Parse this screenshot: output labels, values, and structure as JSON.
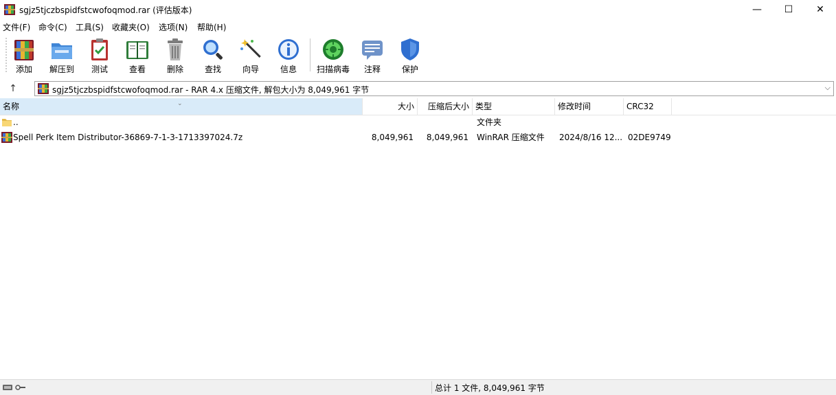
{
  "window": {
    "title": "sgjz5tjczbspidfstcwofoqmod.rar (评估版本)",
    "minimize_glyph": "—",
    "maximize_glyph": "☐",
    "close_glyph": "✕"
  },
  "menu": {
    "items": [
      {
        "label": "文件(F)"
      },
      {
        "label": "命令(C)"
      },
      {
        "label": "工具(S)"
      },
      {
        "label": "收藏夹(O)"
      },
      {
        "label": "选项(N)"
      },
      {
        "label": "帮助(H)"
      }
    ]
  },
  "toolbar": {
    "buttons": [
      {
        "label": "添加",
        "icon": "add-archive-icon"
      },
      {
        "label": "解压到",
        "icon": "extract-folder-icon"
      },
      {
        "label": "测试",
        "icon": "test-clipboard-icon"
      },
      {
        "label": "查看",
        "icon": "view-book-icon"
      },
      {
        "label": "删除",
        "icon": "trash-icon"
      },
      {
        "label": "查找",
        "icon": "magnifier-icon"
      },
      {
        "label": "向导",
        "icon": "wizard-wand-icon"
      },
      {
        "label": "信息",
        "icon": "info-icon"
      },
      {
        "label": "扫描病毒",
        "icon": "virus-scan-icon"
      },
      {
        "label": "注释",
        "icon": "comment-icon"
      },
      {
        "label": "保护",
        "icon": "shield-icon"
      }
    ]
  },
  "address": {
    "up_glyph": "↑",
    "text": "sgjz5tjczbspidfstcwofoqmod.rar - RAR 4.x 压缩文件, 解包大小为 8,049,961 字节",
    "dropdown_glyph": "⌵"
  },
  "columns": {
    "name": "名称",
    "size": "大小",
    "packed": "压缩后大小",
    "type": "类型",
    "modified": "修改时间",
    "crc": "CRC32"
  },
  "rows": [
    {
      "name": "..",
      "size": "",
      "packed": "",
      "type": "文件夹",
      "modified": "",
      "crc": ""
    },
    {
      "name": "Spell Perk Item Distributor-36869-7-1-3-1713397024.7z",
      "size": "8,049,961",
      "packed": "8,049,961",
      "type": "WinRAR 压缩文件",
      "modified": "2024/8/16 12...",
      "crc": "02DE9749"
    }
  ],
  "status": {
    "text": "总计 1 文件, 8,049,961 字节"
  },
  "colors": {
    "selected_header": "#d9ebf9",
    "folder_yellow": "#f8d775",
    "winrar_red": "#8b1a1a"
  }
}
